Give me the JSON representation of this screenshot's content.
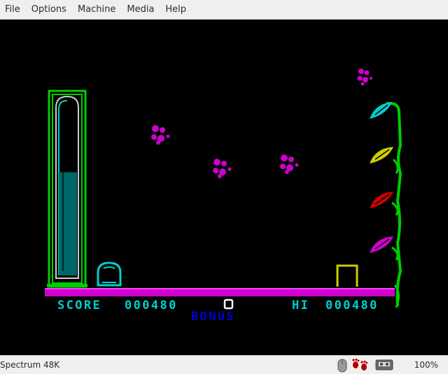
{
  "menu": {
    "file": "File",
    "options": "Options",
    "machine": "Machine",
    "media": "Media",
    "help": "Help"
  },
  "game": {
    "score_label": "SCORE",
    "score_value": "000480",
    "hi_label": "HI",
    "hi_value": "000480",
    "bonus_label": "BONUS",
    "energy_fraction": 0.6
  },
  "status": {
    "machine": "Spectrum 48K",
    "zoom": "100%",
    "icons": [
      "mouse-icon",
      "joystick-footprints-icon",
      "tape-icon"
    ]
  },
  "colors": {
    "cyan": "#00cdcd",
    "magenta": "#cd00cd",
    "green": "#00cd00",
    "yellow": "#cdcd00",
    "red": "#cd0000",
    "blue": "#0000cd",
    "white": "#cdcdcd"
  }
}
